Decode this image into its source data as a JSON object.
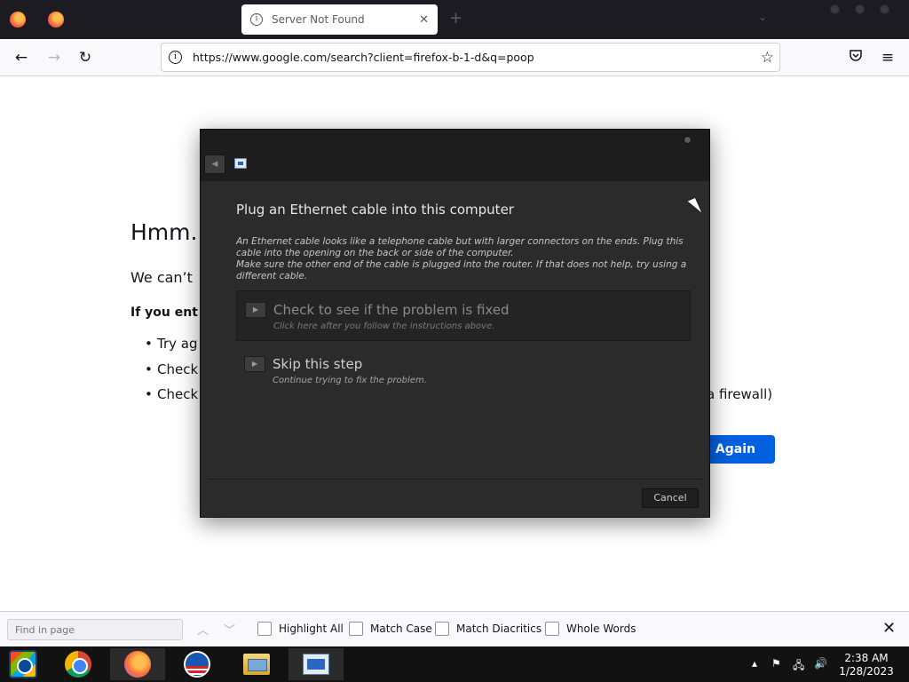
{
  "browser": {
    "tab_title": "Server Not Found",
    "url": "https://www.google.com/search?client=firefox-b-1-d&q=poop"
  },
  "page": {
    "title": "Hmm.",
    "description": "We can’t",
    "bold_line": "If you ent",
    "bullets": [
      "Try ag",
      "Check y",
      "Check t"
    ],
    "bullet_tail": "a firewall)",
    "try_again_label": "Again"
  },
  "dialog": {
    "heading": "Plug an Ethernet cable into this computer",
    "body_line1": "An Ethernet cable looks like a telephone cable but with larger connectors on the ends. Plug this cable into the opening on the back or side of the computer.",
    "body_line2": "Make sure the other end of the cable is plugged into the router. If that does not help, try using a different cable.",
    "options": [
      {
        "title": "Check to see if the problem is fixed",
        "subtitle": "Click here after you follow the instructions above."
      },
      {
        "title": "Skip this step",
        "subtitle": "Continue trying to fix the problem."
      }
    ],
    "cancel_label": "Cancel"
  },
  "findbar": {
    "placeholder": "Find in page",
    "highlight_all": "Highlight All",
    "match_case": "Match Case",
    "match_diacritics": "Match Diacritics",
    "whole_words": "Whole Words"
  },
  "taskbar": {
    "time": "2:38 AM",
    "date": "1/28/2023"
  },
  "icons": {
    "tab_info": "info-icon",
    "back": "back-arrow-icon",
    "forward": "forward-arrow-icon",
    "reload": "reload-icon",
    "bookmark": "star-icon",
    "pocket": "pocket-icon",
    "menu": "hamburger-menu-icon"
  },
  "colors": {
    "try_again": "#0061e0",
    "dialog_bg": "#2b2b2b",
    "tabstrip": "#1c1b22"
  }
}
